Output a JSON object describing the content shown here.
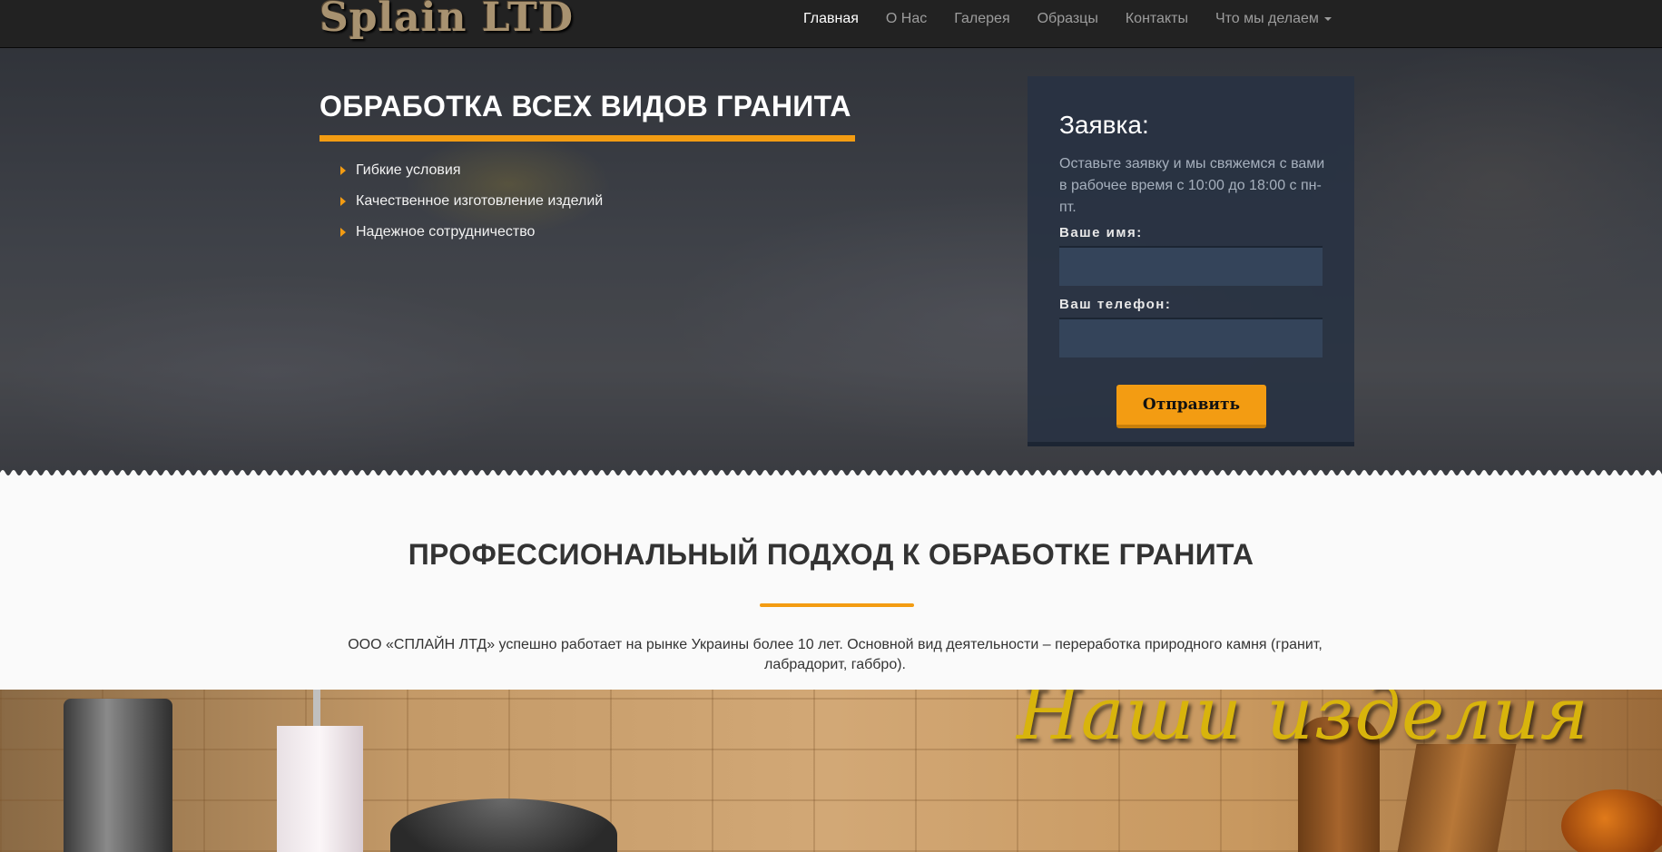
{
  "navbar": {
    "logo": "Splain LTD",
    "items": [
      {
        "label": "Главная",
        "active": true
      },
      {
        "label": "О Нас"
      },
      {
        "label": "Галерея"
      },
      {
        "label": "Образцы"
      },
      {
        "label": "Контакты"
      },
      {
        "label": "Что мы делаем",
        "dropdown": true
      }
    ]
  },
  "hero": {
    "title": "ОБРАБОТКА ВСЕХ ВИДОВ ГРАНИТА",
    "features": [
      "Гибкие условия",
      "Качественное изготовление изделий",
      "Надежное сотрудничество"
    ]
  },
  "form": {
    "title": "Заявка:",
    "description": "Оставьте заявку и мы свяжемся с вами в рабочее время с 10:00 до 18:00 с пн-пт.",
    "name_label": "Ваше имя:",
    "name_value": "",
    "phone_label": "Ваш телефон:",
    "phone_value": "",
    "submit_label": "Отправить"
  },
  "about": {
    "title": "ПРОФЕССИОНАЛЬНЫЙ ПОДХОД К ОБРАБОТКЕ ГРАНИТА",
    "text": "ООО «СПЛАЙН ЛТД» успешно работает на рынке Украины более 10 лет. Основной вид деятельности – переработка природного камня (гранит, лабрадорит, габбро)."
  },
  "products": {
    "title": "Наши изделия"
  },
  "colors": {
    "accent": "#f39c12",
    "navbar": "#222222",
    "form_bg": "#283242"
  }
}
